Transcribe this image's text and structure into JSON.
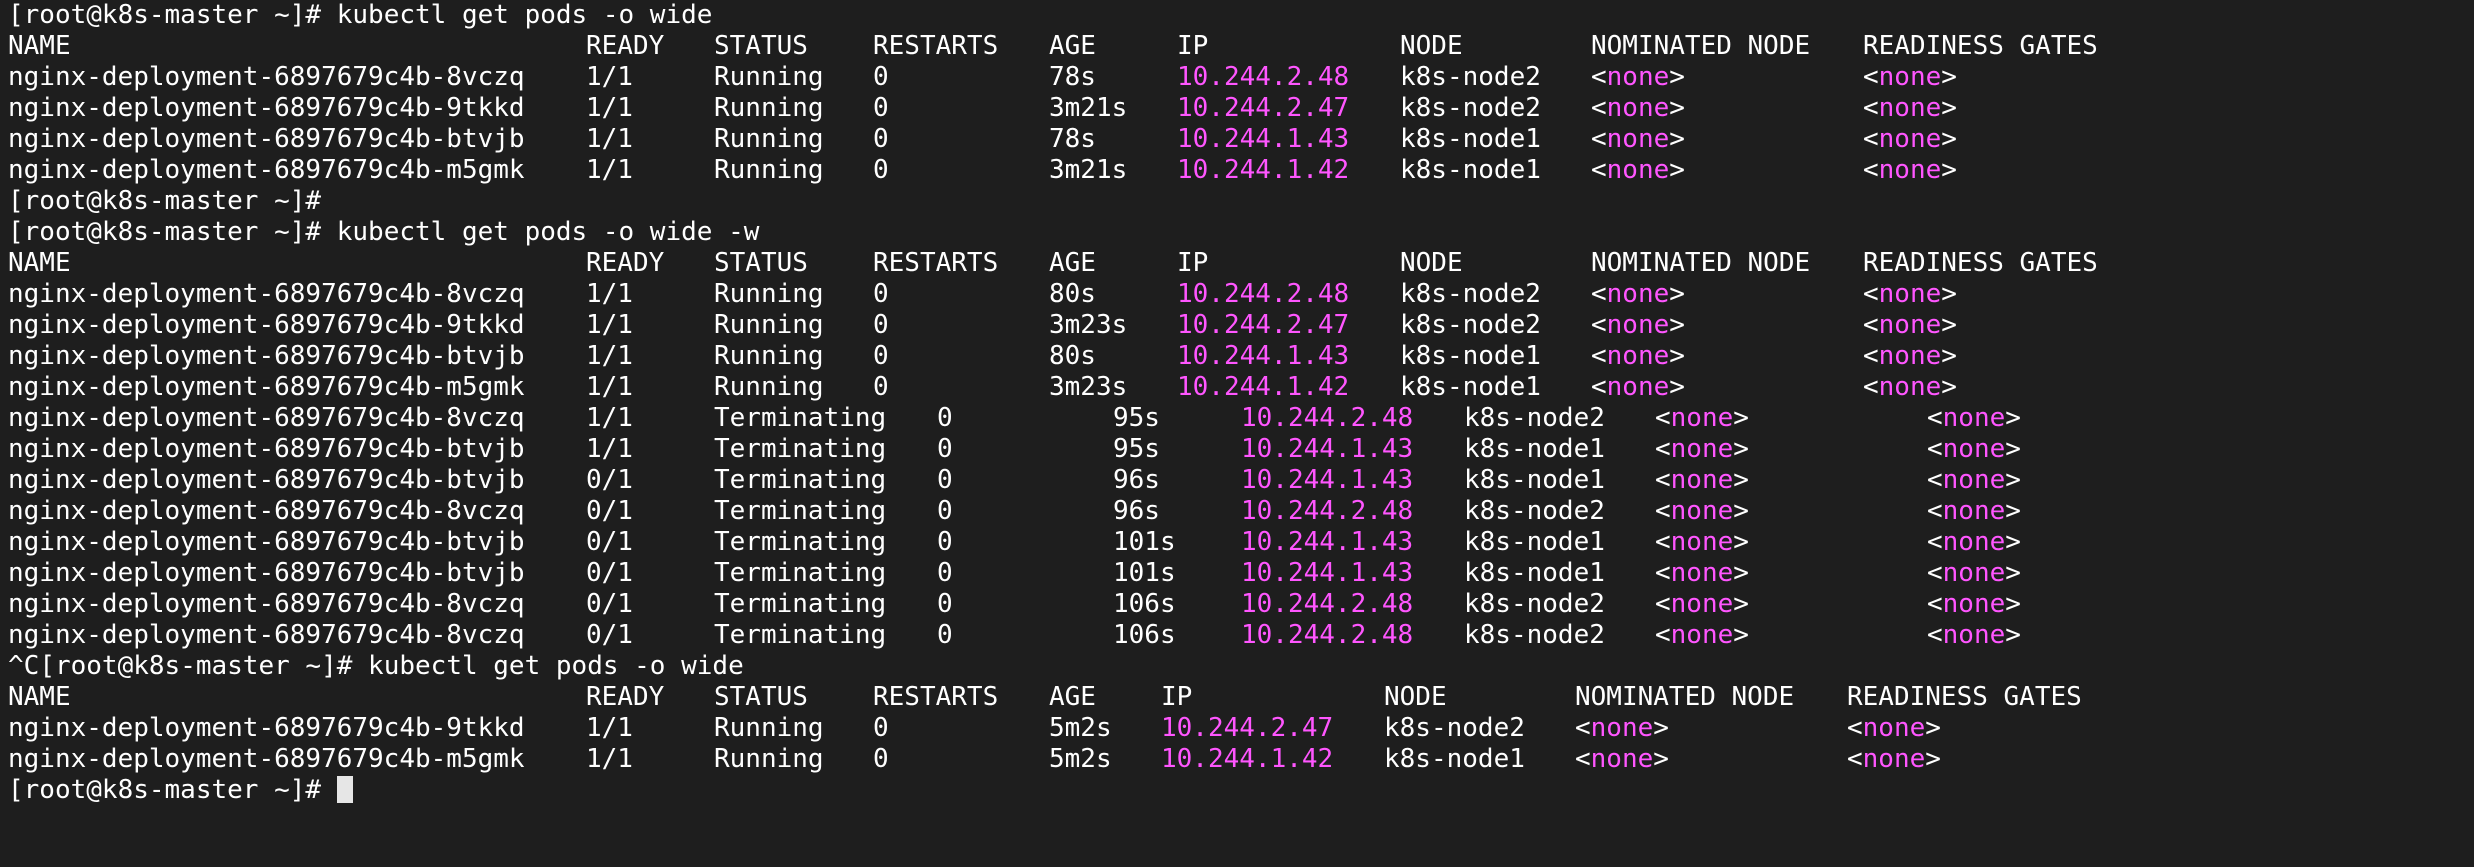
{
  "prompt": "[root@k8s-master ~]# ",
  "blocks": [
    {
      "command": "kubectl get pods -o wide",
      "headers": [
        "NAME",
        "READY",
        "STATUS",
        "RESTARTS",
        "AGE",
        "IP",
        "NODE",
        "NOMINATED NODE",
        "READINESS GATES"
      ],
      "rows": [
        [
          "nginx-deployment-6897679c4b-8vczq",
          "1/1",
          "Running",
          "0",
          "78s",
          "10.244.2.48",
          "k8s-node2",
          "none",
          "none"
        ],
        [
          "nginx-deployment-6897679c4b-9tkkd",
          "1/1",
          "Running",
          "0",
          "3m21s",
          "10.244.2.47",
          "k8s-node2",
          "none",
          "none"
        ],
        [
          "nginx-deployment-6897679c4b-btvjb",
          "1/1",
          "Running",
          "0",
          "78s",
          "10.244.1.43",
          "k8s-node1",
          "none",
          "none"
        ],
        [
          "nginx-deployment-6897679c4b-m5gmk",
          "1/1",
          "Running",
          "0",
          "3m21s",
          "10.244.1.42",
          "k8s-node1",
          "none",
          "none"
        ]
      ]
    },
    {
      "command": "kubectl get pods -o wide -w",
      "headers": [
        "NAME",
        "READY",
        "STATUS",
        "RESTARTS",
        "AGE",
        "IP",
        "NODE",
        "NOMINATED NODE",
        "READINESS GATES"
      ],
      "rows": [
        [
          "nginx-deployment-6897679c4b-8vczq",
          "1/1",
          "Running",
          "0",
          "80s",
          "10.244.2.48",
          "k8s-node2",
          "none",
          "none"
        ],
        [
          "nginx-deployment-6897679c4b-9tkkd",
          "1/1",
          "Running",
          "0",
          "3m23s",
          "10.244.2.47",
          "k8s-node2",
          "none",
          "none"
        ],
        [
          "nginx-deployment-6897679c4b-btvjb",
          "1/1",
          "Running",
          "0",
          "80s",
          "10.244.1.43",
          "k8s-node1",
          "none",
          "none"
        ],
        [
          "nginx-deployment-6897679c4b-m5gmk",
          "1/1",
          "Running",
          "0",
          "3m23s",
          "10.244.1.42",
          "k8s-node1",
          "none",
          "none"
        ]
      ],
      "watch_rows": [
        [
          "nginx-deployment-6897679c4b-8vczq",
          "1/1",
          "Terminating",
          "0",
          "95s",
          "10.244.2.48",
          "k8s-node2",
          "none",
          "none"
        ],
        [
          "nginx-deployment-6897679c4b-btvjb",
          "1/1",
          "Terminating",
          "0",
          "95s",
          "10.244.1.43",
          "k8s-node1",
          "none",
          "none"
        ],
        [
          "nginx-deployment-6897679c4b-btvjb",
          "0/1",
          "Terminating",
          "0",
          "96s",
          "10.244.1.43",
          "k8s-node1",
          "none",
          "none"
        ],
        [
          "nginx-deployment-6897679c4b-8vczq",
          "0/1",
          "Terminating",
          "0",
          "96s",
          "10.244.2.48",
          "k8s-node2",
          "none",
          "none"
        ],
        [
          "nginx-deployment-6897679c4b-btvjb",
          "0/1",
          "Terminating",
          "0",
          "101s",
          "10.244.1.43",
          "k8s-node1",
          "none",
          "none"
        ],
        [
          "nginx-deployment-6897679c4b-btvjb",
          "0/1",
          "Terminating",
          "0",
          "101s",
          "10.244.1.43",
          "k8s-node1",
          "none",
          "none"
        ],
        [
          "nginx-deployment-6897679c4b-8vczq",
          "0/1",
          "Terminating",
          "0",
          "106s",
          "10.244.2.48",
          "k8s-node2",
          "none",
          "none"
        ],
        [
          "nginx-deployment-6897679c4b-8vczq",
          "0/1",
          "Terminating",
          "0",
          "106s",
          "10.244.2.48",
          "k8s-node2",
          "none",
          "none"
        ]
      ],
      "interrupt": "^C"
    },
    {
      "command": "kubectl get pods -o wide",
      "headers": [
        "NAME",
        "READY",
        "STATUS",
        "RESTARTS",
        "AGE",
        "IP",
        "NODE",
        "NOMINATED NODE",
        "READINESS GATES"
      ],
      "rows": [
        [
          "nginx-deployment-6897679c4b-9tkkd",
          "1/1",
          "Running",
          "0",
          "5m2s",
          "10.244.2.47",
          "k8s-node2",
          "none",
          "none"
        ],
        [
          "nginx-deployment-6897679c4b-m5gmk",
          "1/1",
          "Running",
          "0",
          "5m2s",
          "10.244.1.42",
          "k8s-node1",
          "none",
          "none"
        ]
      ]
    }
  ],
  "colors": {
    "background": "#1e1e1e",
    "foreground": "#ffffff",
    "ip": "#ff56ff",
    "cursor": "#e6e6e6"
  }
}
